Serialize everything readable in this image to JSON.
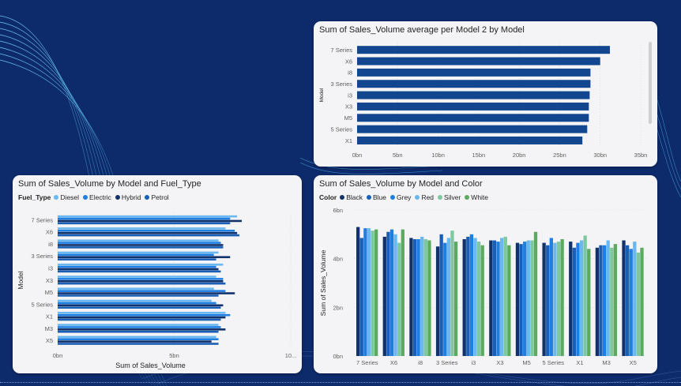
{
  "colors": {
    "background": "#0d2a6b",
    "card": "#f4f3f5",
    "single_bar": "#12478f",
    "axis_text": "#605e5c",
    "grid": "#d8d8d8"
  },
  "charts": {
    "top_right": {
      "title": "Sum of Sales_Volume average per Model 2 by Model"
    },
    "bottom_left": {
      "title": "Sum of Sales_Volume by Model and Fuel_Type",
      "legend_title": "Fuel_Type"
    },
    "bottom_right": {
      "title": "Sum of Sales_Volume by Model and Color",
      "legend_title": "Color"
    }
  },
  "chart_data": [
    {
      "type": "bar",
      "orientation": "horizontal",
      "title": "Sum of Sales_Volume average per Model 2 by Model",
      "categories": [
        "7 Series",
        "X6",
        "i8",
        "3 Series",
        "i3",
        "X3",
        "M5",
        "5 Series",
        "X1"
      ],
      "values": [
        31.2,
        30.0,
        28.8,
        28.8,
        28.7,
        28.6,
        28.6,
        28.4,
        27.8
      ],
      "ylabel": "Model",
      "xlabel": "",
      "xlim": [
        0,
        35
      ],
      "xticks": [
        "0bn",
        "5bn",
        "10bn",
        "15bn",
        "20bn",
        "25bn",
        "30bn",
        "35bn"
      ],
      "xtick_values": [
        0,
        5,
        10,
        15,
        20,
        25,
        30,
        35
      ],
      "unit": "bn",
      "color": "#12478f"
    },
    {
      "type": "bar",
      "orientation": "horizontal",
      "title": "Sum of Sales_Volume by Model and Fuel_Type",
      "categories": [
        "7 Series",
        "X6",
        "i8",
        "3 Series",
        "i3",
        "X3",
        "M5",
        "5 Series",
        "X1",
        "M3",
        "X5"
      ],
      "series": [
        {
          "name": "Diesel",
          "color": "#6ab8f0",
          "values": [
            7.7,
            7.2,
            6.9,
            6.9,
            7.1,
            6.8,
            6.7,
            6.6,
            7.2,
            6.9,
            6.8
          ]
        },
        {
          "name": "Electric",
          "color": "#1f7fe0",
          "values": [
            7.4,
            7.6,
            7.0,
            6.7,
            6.8,
            7.1,
            7.2,
            6.8,
            7.4,
            7.0,
            6.9
          ]
        },
        {
          "name": "Hybrid",
          "color": "#12326c",
          "values": [
            7.9,
            7.7,
            7.1,
            7.4,
            6.9,
            7.1,
            7.6,
            7.1,
            7.2,
            7.2,
            6.6
          ]
        },
        {
          "name": "Petrol",
          "color": "#1a5fb6",
          "values": [
            7.4,
            7.8,
            7.1,
            6.8,
            7.0,
            7.2,
            6.9,
            7.0,
            7.0,
            6.9,
            6.9
          ]
        }
      ],
      "xlabel": "Sum of Sales_Volume",
      "ylabel": "Model",
      "xlim": [
        0,
        10
      ],
      "xticks": [
        "0bn",
        "5bn",
        "10..."
      ],
      "xtick_values": [
        0,
        5,
        10
      ],
      "unit": "bn"
    },
    {
      "type": "bar",
      "orientation": "vertical",
      "title": "Sum of Sales_Volume by Model and Color",
      "categories": [
        "7 Series",
        "X6",
        "i8",
        "3 Series",
        "i3",
        "X3",
        "M5",
        "5 Series",
        "X1",
        "M3",
        "X5"
      ],
      "series": [
        {
          "name": "Black",
          "color": "#12326c",
          "values": [
            5.3,
            4.9,
            4.85,
            4.5,
            4.8,
            4.75,
            4.65,
            4.65,
            4.7,
            4.45,
            4.75
          ]
        },
        {
          "name": "Blue",
          "color": "#1a5fb6",
          "values": [
            4.85,
            5.1,
            4.8,
            5.0,
            4.9,
            4.75,
            4.6,
            4.55,
            4.45,
            4.55,
            4.55
          ]
        },
        {
          "name": "Grey",
          "color": "#1f7fe0",
          "values": [
            5.25,
            5.2,
            4.8,
            4.65,
            5.0,
            4.7,
            4.7,
            4.85,
            4.65,
            4.55,
            4.4
          ]
        },
        {
          "name": "Red",
          "color": "#6ab8f0",
          "values": [
            5.25,
            5.0,
            4.9,
            4.85,
            4.85,
            4.85,
            4.75,
            4.65,
            4.75,
            4.75,
            4.7
          ]
        },
        {
          "name": "Silver",
          "color": "#7ec8a0",
          "values": [
            5.15,
            4.65,
            4.8,
            5.15,
            4.7,
            4.9,
            4.75,
            4.7,
            4.95,
            4.45,
            4.25
          ]
        },
        {
          "name": "White",
          "color": "#5aab5f",
          "values": [
            5.2,
            5.2,
            4.75,
            4.7,
            4.55,
            4.55,
            5.1,
            4.8,
            4.4,
            4.6,
            4.45
          ]
        }
      ],
      "xlabel": "",
      "ylabel": "Sum of Sales_Volume",
      "ylim": [
        0,
        6
      ],
      "yticks": [
        "0bn",
        "2bn",
        "4bn",
        "6bn"
      ],
      "ytick_values": [
        0,
        2,
        4,
        6
      ],
      "unit": "bn"
    }
  ]
}
